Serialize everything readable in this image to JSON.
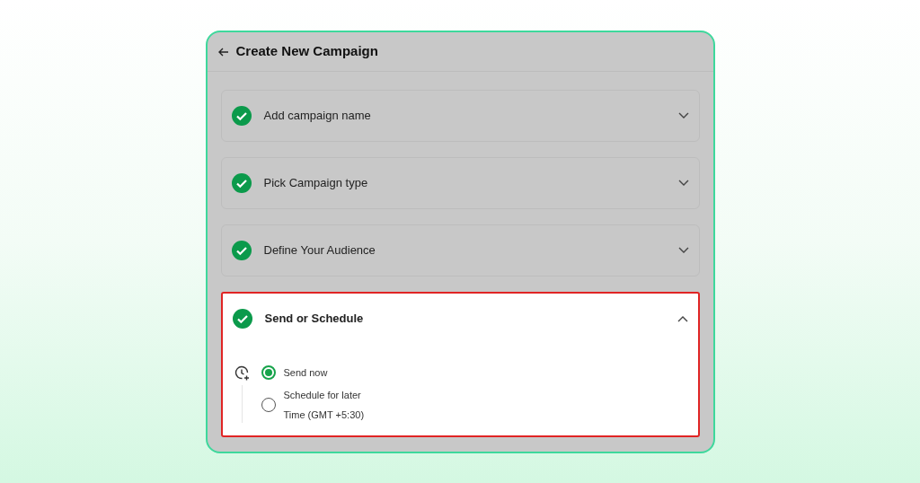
{
  "header": {
    "title": "Create New Campaign"
  },
  "steps": [
    {
      "label": "Add campaign name",
      "completed": true,
      "expanded": false,
      "highlighted": false
    },
    {
      "label": "Pick Campaign type",
      "completed": true,
      "expanded": false,
      "highlighted": false
    },
    {
      "label": "Define Your Audience",
      "completed": true,
      "expanded": false,
      "highlighted": false
    },
    {
      "label": "Send or Schedule",
      "completed": true,
      "expanded": true,
      "highlighted": true,
      "options": [
        {
          "label": "Send now",
          "selected": true
        },
        {
          "label": "Schedule for later",
          "detail": "Time (GMT +5:30)",
          "selected": false
        }
      ]
    }
  ]
}
